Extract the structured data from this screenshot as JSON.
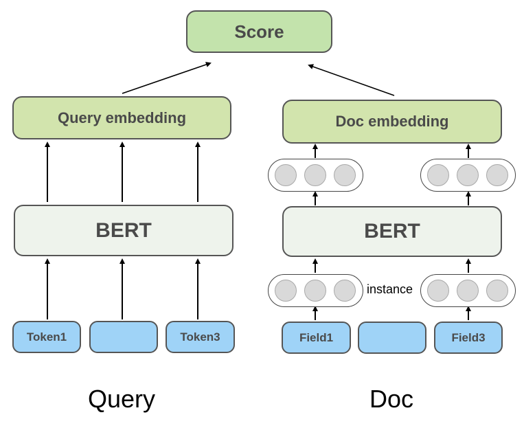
{
  "score": {
    "label": "Score"
  },
  "query": {
    "embedding_label": "Query embedding",
    "model_label": "BERT",
    "tokens": [
      "Token1",
      "",
      "Token3"
    ],
    "caption": "Query"
  },
  "doc": {
    "embedding_label": "Doc embedding",
    "model_label": "BERT",
    "fields": [
      "Field1",
      "",
      "Field3"
    ],
    "instance_label": "instance",
    "caption": "Doc"
  },
  "colors": {
    "score_fill": "#c3e3ac",
    "embedding_fill": "#d2e4ad",
    "bert_fill": "#eef3ec",
    "token_fill": "#9fd3f7",
    "node_fill": "#d9d9d9",
    "border": "#555555"
  }
}
